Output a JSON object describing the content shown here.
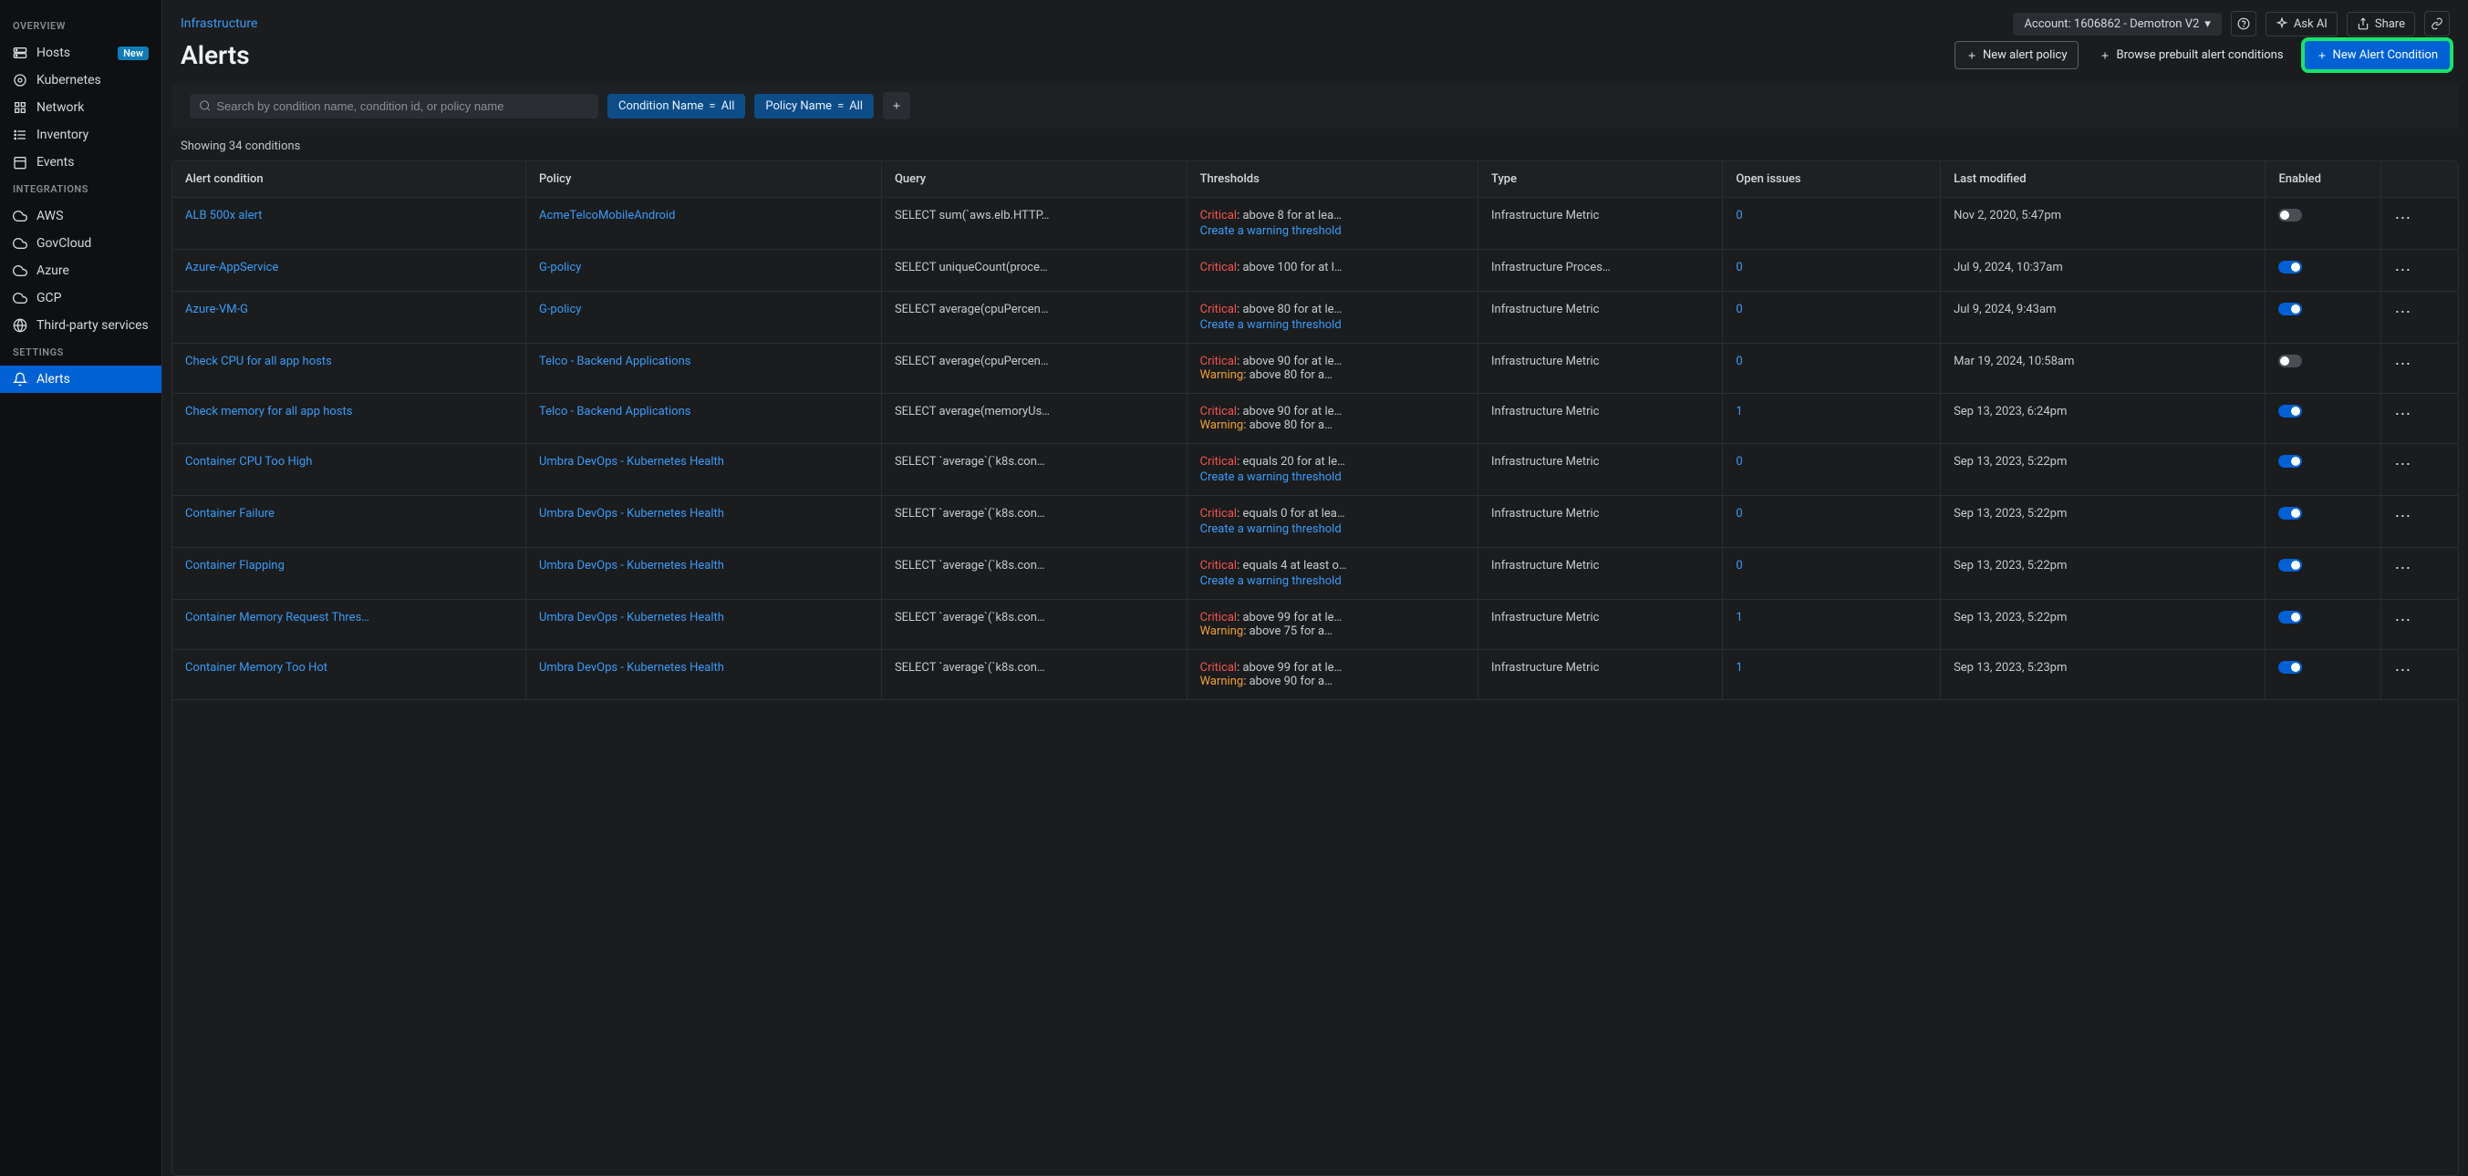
{
  "sidebar": {
    "sections": [
      {
        "title": "OVERVIEW",
        "items": [
          {
            "label": "Hosts",
            "icon": "server-icon",
            "badge": "New"
          },
          {
            "label": "Kubernetes",
            "icon": "kubernetes-icon"
          },
          {
            "label": "Network",
            "icon": "network-icon"
          },
          {
            "label": "Inventory",
            "icon": "list-icon"
          },
          {
            "label": "Events",
            "icon": "calendar-icon"
          }
        ]
      },
      {
        "title": "INTEGRATIONS",
        "items": [
          {
            "label": "AWS",
            "icon": "cloud-icon"
          },
          {
            "label": "GovCloud",
            "icon": "cloud-icon"
          },
          {
            "label": "Azure",
            "icon": "cloud-icon"
          },
          {
            "label": "GCP",
            "icon": "cloud-icon"
          },
          {
            "label": "Third-party services",
            "icon": "globe-icon"
          }
        ]
      },
      {
        "title": "SETTINGS",
        "items": [
          {
            "label": "Alerts",
            "icon": "bell-icon",
            "active": true
          }
        ]
      }
    ]
  },
  "breadcrumb": "Infrastructure",
  "page_title": "Alerts",
  "account_chip": "Account: 1606862 - Demotron V2",
  "top_buttons": {
    "ask_ai": "Ask AI",
    "share": "Share"
  },
  "header_buttons": {
    "new_policy": "New alert policy",
    "browse_prebuilt": "Browse prebuilt alert conditions",
    "new_condition": "New Alert Condition"
  },
  "search": {
    "placeholder": "Search by condition name, condition id, or policy name"
  },
  "filters": {
    "condition_name": {
      "label": "Condition Name",
      "op": "=",
      "value": "All"
    },
    "policy_name": {
      "label": "Policy Name",
      "op": "=",
      "value": "All"
    }
  },
  "result_count": "Showing 34 conditions",
  "columns": {
    "alert_condition": "Alert condition",
    "policy": "Policy",
    "query": "Query",
    "thresholds": "Thresholds",
    "type": "Type",
    "open_issues": "Open issues",
    "last_modified": "Last modified",
    "enabled": "Enabled"
  },
  "labels": {
    "critical": "Critical",
    "warning": "Warning",
    "create_warning": "Create a warning threshold"
  },
  "rows": [
    {
      "condition": "ALB 500x alert",
      "policy": "AcmeTelcoMobileAndroid",
      "query": "SELECT sum(`aws.elb.HTTP…",
      "critical": ": above 8 for at lea…",
      "warning": null,
      "create_warning": true,
      "type": "Infrastructure Metric",
      "open_issues": "0",
      "last_modified": "Nov 2, 2020, 5:47pm",
      "enabled": false
    },
    {
      "condition": "Azure-AppService",
      "policy": "G-policy",
      "query": "SELECT uniqueCount(proce…",
      "critical": ": above 100 for at l…",
      "warning": null,
      "create_warning": false,
      "type": "Infrastructure Proces…",
      "open_issues": "0",
      "last_modified": "Jul 9, 2024, 10:37am",
      "enabled": true
    },
    {
      "condition": "Azure-VM-G",
      "policy": "G-policy",
      "query": "SELECT average(cpuPercen…",
      "critical": ": above 80 for at le…",
      "warning": null,
      "create_warning": true,
      "type": "Infrastructure Metric",
      "open_issues": "0",
      "last_modified": "Jul 9, 2024, 9:43am",
      "enabled": true
    },
    {
      "condition": "Check CPU for all app hosts",
      "policy": "Telco - Backend Applications",
      "query": "SELECT average(cpuPercen…",
      "critical": ": above 90 for at le…",
      "warning": ": above 80 for a…",
      "create_warning": false,
      "type": "Infrastructure Metric",
      "open_issues": "0",
      "last_modified": "Mar 19, 2024, 10:58am",
      "enabled": false
    },
    {
      "condition": "Check memory for all app hosts",
      "policy": "Telco - Backend Applications",
      "query": "SELECT average(memoryUs…",
      "critical": ": above 90 for at le…",
      "warning": ": above 80 for a…",
      "create_warning": false,
      "type": "Infrastructure Metric",
      "open_issues": "1",
      "last_modified": "Sep 13, 2023, 6:24pm",
      "enabled": true
    },
    {
      "condition": "Container CPU Too High",
      "policy": "Umbra DevOps - Kubernetes Health",
      "query": "SELECT `average`(`k8s.con…",
      "critical": ": equals 20 for at le…",
      "warning": null,
      "create_warning": true,
      "type": "Infrastructure Metric",
      "open_issues": "0",
      "last_modified": "Sep 13, 2023, 5:22pm",
      "enabled": true
    },
    {
      "condition": "Container Failure",
      "policy": "Umbra DevOps - Kubernetes Health",
      "query": "SELECT `average`(`k8s.con…",
      "critical": ": equals 0 for at lea…",
      "warning": null,
      "create_warning": true,
      "type": "Infrastructure Metric",
      "open_issues": "0",
      "last_modified": "Sep 13, 2023, 5:22pm",
      "enabled": true
    },
    {
      "condition": "Container Flapping",
      "policy": "Umbra DevOps - Kubernetes Health",
      "query": "SELECT `average`(`k8s.con…",
      "critical": ": equals 4 at least o…",
      "warning": null,
      "create_warning": true,
      "type": "Infrastructure Metric",
      "open_issues": "0",
      "last_modified": "Sep 13, 2023, 5:22pm",
      "enabled": true
    },
    {
      "condition": "Container Memory Request Thres…",
      "policy": "Umbra DevOps - Kubernetes Health",
      "query": "SELECT `average`(`k8s.con…",
      "critical": ": above 99 for at le…",
      "warning": ": above 75 for a…",
      "create_warning": false,
      "type": "Infrastructure Metric",
      "open_issues": "1",
      "last_modified": "Sep 13, 2023, 5:22pm",
      "enabled": true
    },
    {
      "condition": "Container Memory Too Hot",
      "policy": "Umbra DevOps - Kubernetes Health",
      "query": "SELECT `average`(`k8s.con…",
      "critical": ": above 99 for at le…",
      "warning": ": above 90 for a…",
      "create_warning": false,
      "type": "Infrastructure Metric",
      "open_issues": "1",
      "last_modified": "Sep 13, 2023, 5:23pm",
      "enabled": true
    }
  ]
}
